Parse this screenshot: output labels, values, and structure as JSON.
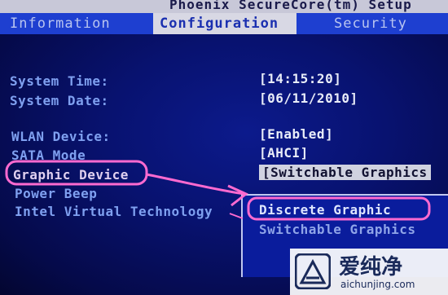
{
  "header": {
    "bios_title": "Phoenix SecureCore(tm) Setup"
  },
  "tabs": [
    {
      "label": "Information",
      "active": false
    },
    {
      "label": "Configuration",
      "active": true
    },
    {
      "label": "Security",
      "active": false
    }
  ],
  "settings": {
    "system_time": {
      "label": "System Time:",
      "value": "[14:15:20]"
    },
    "system_date": {
      "label": "System Date:",
      "value": "[06/11/2010]"
    },
    "wlan_device": {
      "label": "WLAN Device:",
      "value": "[Enabled]"
    },
    "sata_mode": {
      "label": "SATA Mode",
      "value": "[AHCI]"
    },
    "graphic_device": {
      "label": "Graphic Device",
      "value": "[Switchable Graphics"
    },
    "power_beep": {
      "label": "Power Beep"
    },
    "intel_vt": {
      "label": "Intel Virtual Technology"
    }
  },
  "popup": {
    "options": [
      "Discrete Graphic",
      "Switchable Graphics"
    ],
    "highlighted": "Discrete Graphic"
  },
  "watermark": {
    "brand_cn": "爱纯净",
    "url": "aichunjing.com"
  },
  "colors": {
    "background": "#081270",
    "tab_bar": "#1e3fd0",
    "label_text": "#7fa0f0",
    "value_text": "#e8ecf8",
    "annotation": "#ff6ad0"
  }
}
